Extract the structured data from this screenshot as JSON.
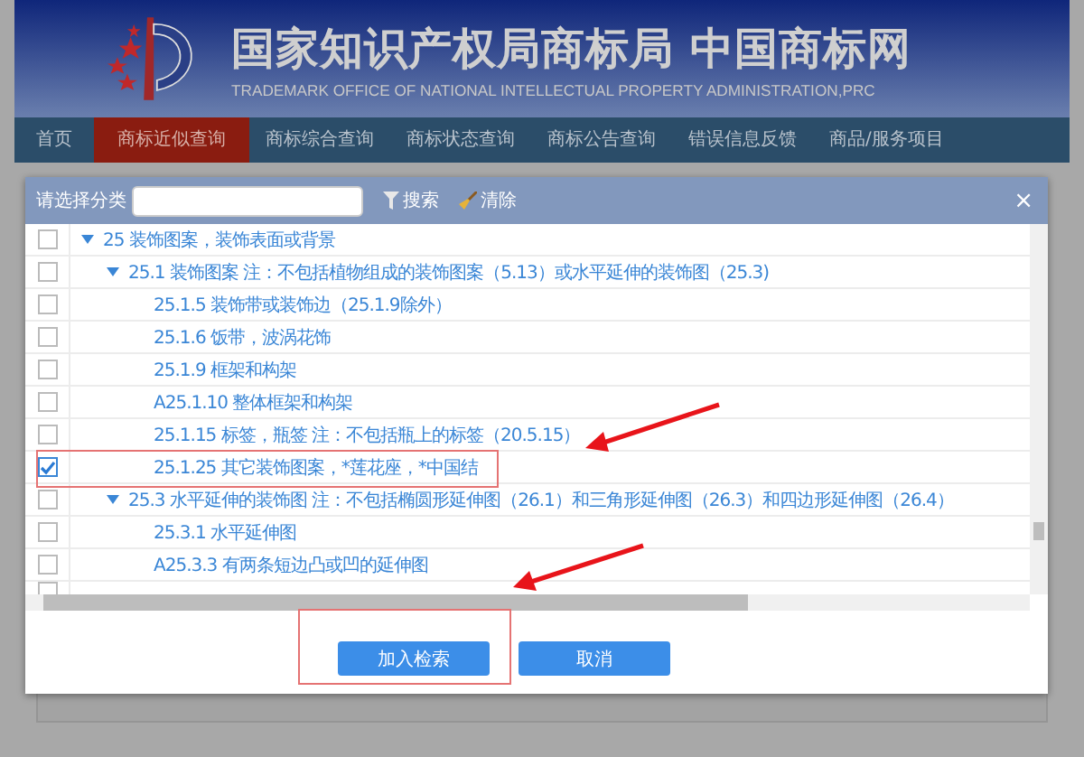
{
  "header": {
    "title": "国家知识产权局商标局 中国商标网",
    "subtitle": "TRADEMARK OFFICE OF NATIONAL INTELLECTUAL PROPERTY ADMINISTRATION,PRC"
  },
  "nav": [
    {
      "label": "首页",
      "selected": false
    },
    {
      "label": "商标近似查询",
      "selected": true
    },
    {
      "label": "商标综合查询",
      "selected": false
    },
    {
      "label": "商标状态查询",
      "selected": false
    },
    {
      "label": "商标公告查询",
      "selected": false
    },
    {
      "label": "错误信息反馈",
      "selected": false
    },
    {
      "label": "商品/服务项目",
      "selected": false
    }
  ],
  "dialog": {
    "filter_label": "请选择分类",
    "search_button": "搜索",
    "clear_button": "清除",
    "close": "×",
    "tree": [
      {
        "label": "25 装饰图案，装饰表面或背景",
        "checked": false,
        "expanded": true,
        "children": [
          {
            "label": "25.1 装饰图案 注：不包括植物组成的装饰图案（5.13）或水平延伸的装饰图（25.3)",
            "checked": false,
            "expanded": true,
            "children": [
              {
                "label": "25.1.5 装饰带或装饰边（25.1.9除外）",
                "checked": false
              },
              {
                "label": "25.1.6 饭带，波涡花饰",
                "checked": false
              },
              {
                "label": "25.1.9 框架和构架",
                "checked": false
              },
              {
                "label": "A25.1.10 整体框架和构架",
                "checked": false
              },
              {
                "label": "25.1.15 标签，瓶签 注：不包括瓶上的标签（20.5.15）",
                "checked": false
              },
              {
                "label": "25.1.25 其它装饰图案，*莲花座，*中国结",
                "checked": true
              }
            ]
          },
          {
            "label": "25.3 水平延伸的装饰图 注：不包括椭圆形延伸图（26.1）和三角形延伸图（26.3）和四边形延伸图（26.4）",
            "checked": false,
            "expanded": true,
            "children": [
              {
                "label": "25.3.1 水平延伸图",
                "checked": false
              },
              {
                "label": "A25.3.3 有两条短边凸或凹的延伸图",
                "checked": false
              }
            ]
          }
        ]
      }
    ],
    "buttons": [
      {
        "label": "加入检索"
      },
      {
        "label": "取消"
      }
    ]
  }
}
